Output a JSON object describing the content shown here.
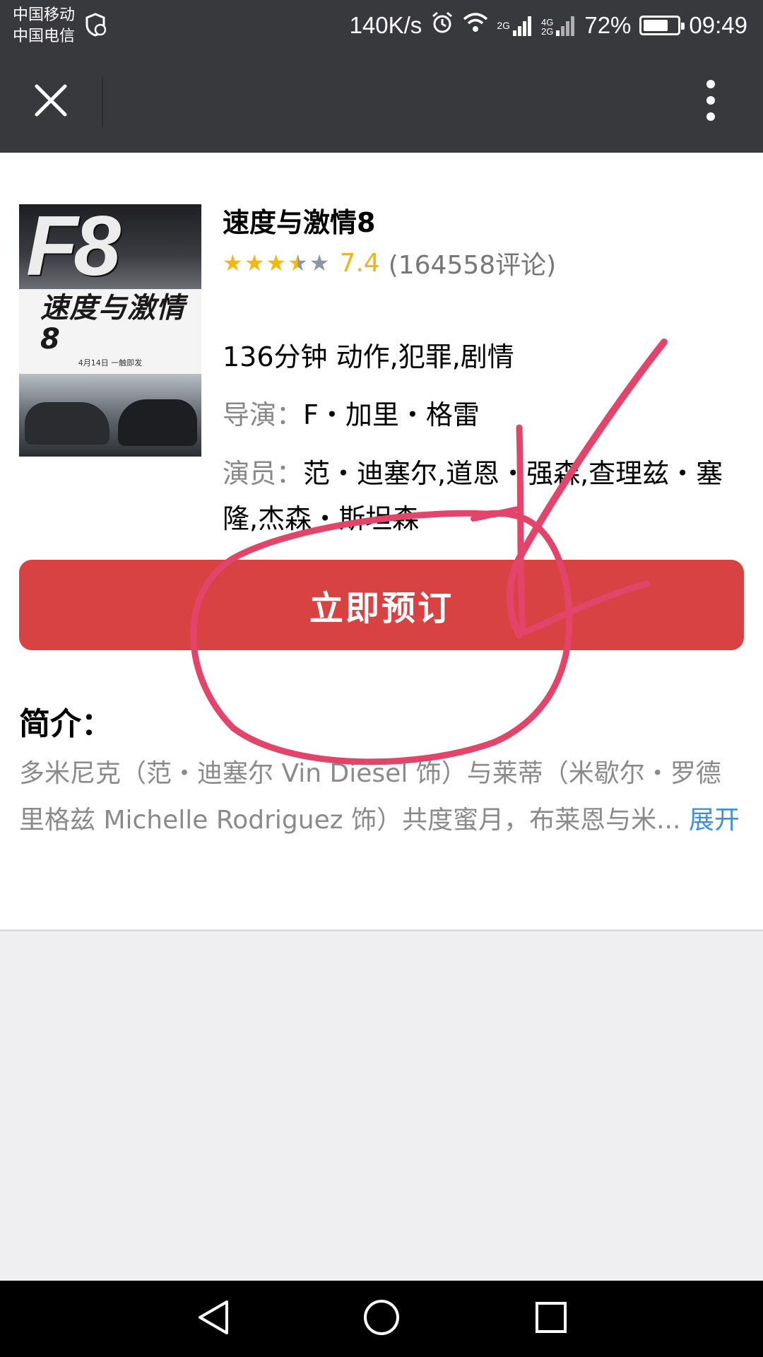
{
  "status_bar": {
    "carrier_1": "中国移动",
    "carrier_2": "中国电信",
    "net_speed": "140K/s",
    "signal_1_type": "2G",
    "signal_2_type_top": "4G",
    "signal_2_type_bottom": "2G",
    "battery": "72%",
    "battery_level": 0.72,
    "time": "09:49"
  },
  "nav": {
    "close_icon": "close-icon",
    "more_icon": "more-vertical-icon"
  },
  "movie": {
    "title": "速度与激情8",
    "rating_stars": 3.5,
    "rating_score": "7.4",
    "review_count": "(164558评论)",
    "meta": "136分钟 动作,犯罪,剧情",
    "director_label": "导演：",
    "director": "F・加里・格雷",
    "cast_label": "演员：",
    "cast": "范・迪塞尔,道恩・强森,查理兹・塞隆,杰森・斯坦森",
    "poster": {
      "logo": "F8",
      "title": "速度与激情8",
      "date": "4月14日 一触即发"
    }
  },
  "book_button": "立即预订",
  "synopsis": {
    "title": "简介：",
    "text": "多米尼克（范・迪塞尔 Vin Diesel 饰）与莱蒂（米歇尔・罗德里格兹 Michelle Rodriguez 饰）共度蜜月，布莱恩与米...",
    "expand": "展开"
  },
  "colors": {
    "top_bar": "#38393d",
    "accent_red": "#d84243",
    "star_gold": "#f5b80f",
    "link_blue": "#3d8fe0",
    "annotation_pink": "#e3456a"
  },
  "bottom_nav": {
    "back_icon": "back-triangle-icon",
    "home_icon": "home-circle-icon",
    "recents_icon": "recents-square-icon"
  }
}
